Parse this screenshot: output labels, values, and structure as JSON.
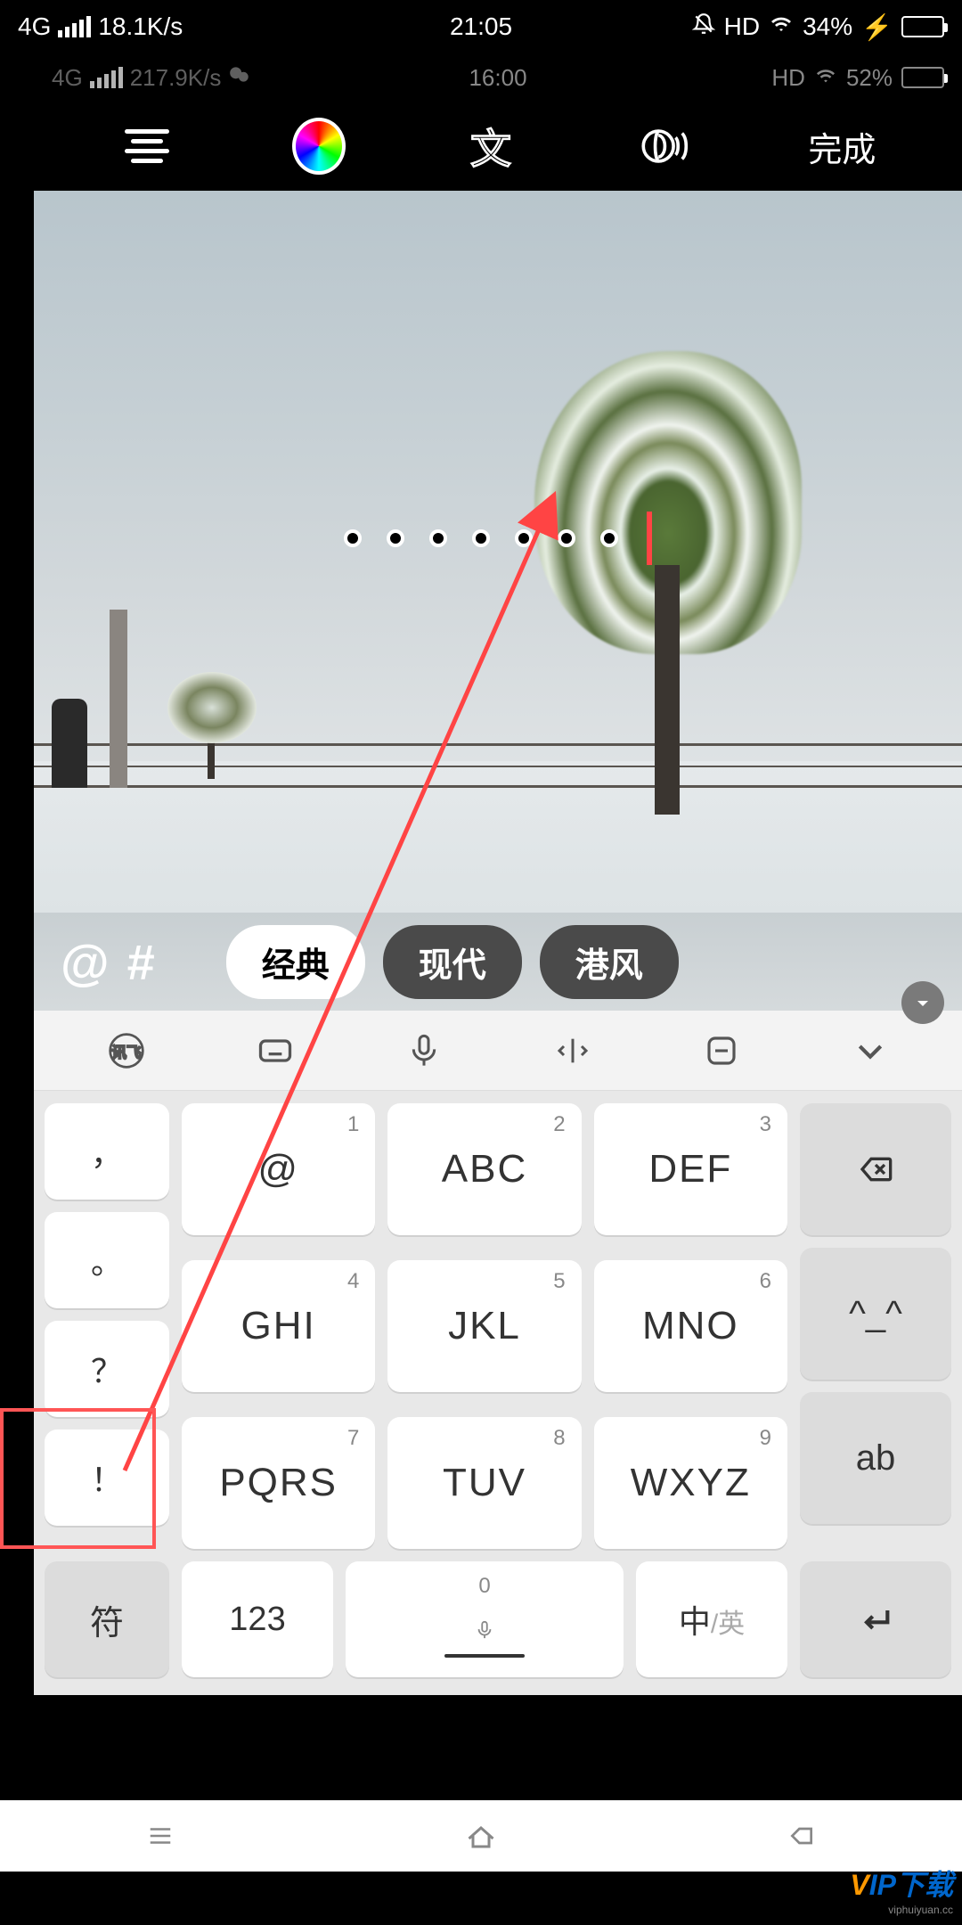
{
  "outer_status": {
    "network": "4G",
    "speed": "18.1K/s",
    "time": "21:05",
    "hd": "HD",
    "battery_pct": "34%",
    "charging": "⚡"
  },
  "inner_status": {
    "network": "4G",
    "speed": "217.9K/s",
    "time": "16:00",
    "hd": "HD",
    "battery_pct": "52%"
  },
  "toolbar": {
    "done": "完成",
    "text_icon_label": "文"
  },
  "text_input": {
    "value": "。。。。。。。"
  },
  "style_bar": {
    "at": "@",
    "hash": "#",
    "styles": [
      "经典",
      "现代",
      "港风"
    ],
    "active_index": 0
  },
  "keyboard": {
    "left_col": [
      "，",
      "。",
      "？",
      "！"
    ],
    "grid": [
      [
        {
          "n": "1",
          "l": "@"
        },
        {
          "n": "2",
          "l": "ABC"
        },
        {
          "n": "3",
          "l": "DEF"
        }
      ],
      [
        {
          "n": "4",
          "l": "GHI"
        },
        {
          "n": "5",
          "l": "JKL"
        },
        {
          "n": "6",
          "l": "MNO"
        }
      ],
      [
        {
          "n": "7",
          "l": "PQRS"
        },
        {
          "n": "8",
          "l": "TUV"
        },
        {
          "n": "9",
          "l": "WXYZ"
        }
      ]
    ],
    "right_col": {
      "emoji": "^_^",
      "ab": "ab"
    },
    "bottom": {
      "sym": "符",
      "num": "123",
      "space_n": "0",
      "lang_active": "中",
      "lang_inactive": "/英"
    }
  },
  "watermark": {
    "brand_v": "V",
    "brand_ip": "IP",
    "brand_suffix": "下载",
    "url": "viphuiyuan.cc"
  }
}
